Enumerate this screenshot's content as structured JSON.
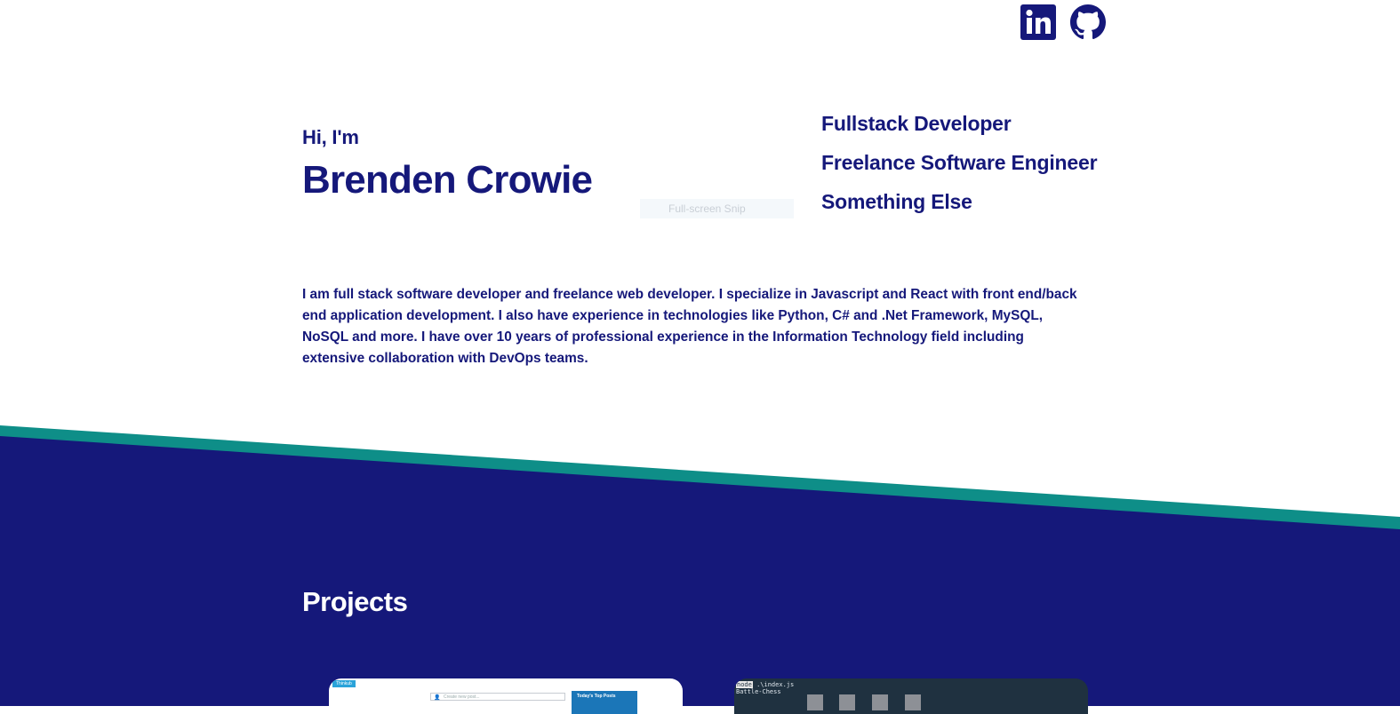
{
  "social": {
    "linkedin": {
      "icon": "linkedin-icon",
      "label": "in"
    },
    "github": {
      "icon": "github-icon"
    }
  },
  "hero": {
    "greeting": "Hi, I'm",
    "name": "Brenden Crowie",
    "roles": [
      "Fullstack Developer",
      "Freelance Software Engineer",
      "Something Else"
    ]
  },
  "overlay": {
    "snip_label": "Full-screen Snip"
  },
  "bio": "I am full stack software developer and freelance web developer. I specialize in Javascript and React with front end/back end application development. I also have experience in technologies like Python, C# and .Net Framework, MySQL, NoSQL and more. I have over 10 years of professional experience in the Information Technology field including extensive collaboration with DevOps teams.",
  "projects": {
    "title": "Projects",
    "cards": [
      {
        "badge": "Thinkub",
        "input_placeholder": "Create new post...",
        "panel_title": "Today's Top Posts"
      },
      {
        "terminal_command": "node",
        "terminal_arg": ".\\index.js",
        "terminal_output": "Battle-Chess"
      }
    ]
  },
  "colors": {
    "primary": "#15187a",
    "accent": "#0e8e88",
    "background": "#ffffff",
    "terminal": "#1f3140"
  }
}
